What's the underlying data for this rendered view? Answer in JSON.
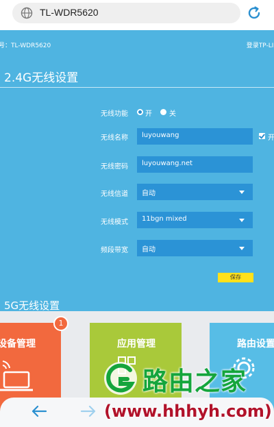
{
  "address_bar": {
    "url": "TL-WDR5620"
  },
  "router_page": {
    "model_text": "号：TL-WDR5620",
    "brand_text": "登录TP-LINK",
    "section_title": "2.4G无线设置",
    "wireless_function": {
      "label": "无线功能",
      "on_label": "开",
      "off_label": "关",
      "selected": "开"
    },
    "ssid": {
      "label": "无线名称",
      "value": "luyouwang",
      "checkbox_label": "开"
    },
    "password": {
      "label": "无线密码",
      "value": "luyouwang.net"
    },
    "channel": {
      "label": "无线信道",
      "value": "自动"
    },
    "mode": {
      "label": "无线模式",
      "value": "11bgn mixed"
    },
    "bandwidth": {
      "label": "频段带宽",
      "value": "自动"
    },
    "save_label": "保存",
    "section_title_5g": "5G无线设置"
  },
  "app_tiles": [
    {
      "label": "设备管理",
      "badge": "1",
      "icon": "laptop-icon"
    },
    {
      "label": "应用管理",
      "icon": "apps-icon"
    },
    {
      "label": "路由设置",
      "icon": "gear-icon"
    }
  ],
  "watermark": {
    "cn": "路由之家",
    "url": "(www.hhhyh.com)"
  },
  "browser_nav": {
    "back_icon": "back-arrow-icon",
    "forward_icon": "forward-arrow-icon"
  },
  "colors": {
    "page_bg": "#4fb4e1",
    "field_bg": "#2b93d6",
    "save_button": "#ffe11b",
    "tile_device": "#f2693e",
    "tile_apps": "#a9c93a",
    "tile_router": "#57bde6",
    "watermark_green": "#15a53c",
    "watermark_red": "#b1122a"
  }
}
